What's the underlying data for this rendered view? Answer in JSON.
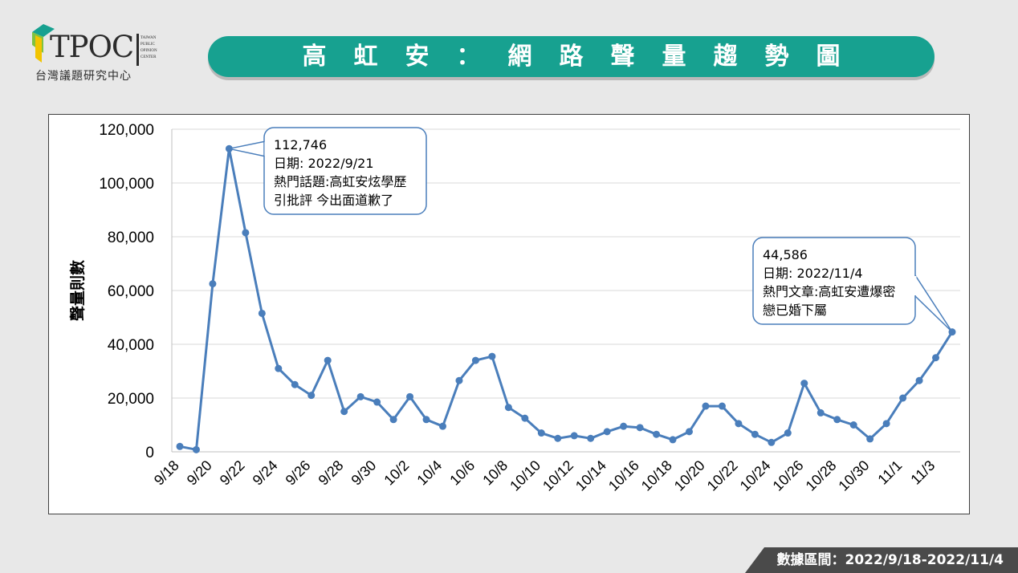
{
  "logo": {
    "wordmark": "TPOC",
    "side_text": "TAIWAN PUBLIC OPINION CENTER",
    "org_name": "台灣議題研究中心"
  },
  "title": "高虹安：網路聲量趨勢圖",
  "footer": {
    "label": "數據區間：2022/9/18-2022/11/4"
  },
  "colors": {
    "accent": "#17a190",
    "line": "#4a7ebb",
    "footer_bg": "#4a4a4a"
  },
  "chart_data": {
    "type": "line",
    "ylabel": "聲量則數",
    "ylim": [
      0,
      120000
    ],
    "yticks": [
      "0",
      "20,000",
      "40,000",
      "60,000",
      "80,000",
      "100,000",
      "120,000"
    ],
    "ytick_values": [
      0,
      20000,
      40000,
      60000,
      80000,
      100000,
      120000
    ],
    "grid": true,
    "xtick_labels": [
      "9/18",
      "9/20",
      "9/22",
      "9/24",
      "9/26",
      "9/28",
      "9/30",
      "10/2",
      "10/4",
      "10/6",
      "10/8",
      "10/10",
      "10/12",
      "10/14",
      "10/16",
      "10/18",
      "10/20",
      "10/22",
      "10/24",
      "10/26",
      "10/28",
      "10/30",
      "11/1",
      "11/3"
    ],
    "categories": [
      "9/18",
      "9/19",
      "9/20",
      "9/21",
      "9/22",
      "9/23",
      "9/24",
      "9/25",
      "9/26",
      "9/27",
      "9/28",
      "9/29",
      "9/30",
      "10/1",
      "10/2",
      "10/3",
      "10/4",
      "10/5",
      "10/6",
      "10/7",
      "10/8",
      "10/9",
      "10/10",
      "10/11",
      "10/12",
      "10/13",
      "10/14",
      "10/15",
      "10/16",
      "10/17",
      "10/18",
      "10/19",
      "10/20",
      "10/21",
      "10/22",
      "10/23",
      "10/24",
      "10/25",
      "10/26",
      "10/27",
      "10/28",
      "10/29",
      "10/30",
      "10/31",
      "11/1",
      "11/2",
      "11/3",
      "11/4"
    ],
    "values": [
      2000,
      800,
      62500,
      112746,
      81500,
      51500,
      31000,
      25000,
      21000,
      34000,
      15000,
      20500,
      18500,
      12000,
      20500,
      12000,
      9500,
      26500,
      34000,
      35500,
      16500,
      12500,
      7000,
      5000,
      6000,
      5000,
      7500,
      9500,
      9000,
      6500,
      4500,
      7500,
      17000,
      17000,
      10500,
      6500,
      3500,
      7000,
      25500,
      14500,
      12000,
      10000,
      4800,
      10500,
      20000,
      26500,
      35000,
      44586
    ],
    "annotations": [
      {
        "index": 3,
        "lines": [
          "112,746",
          "日期: 2022/9/21",
          "熱門話題:高虹安炫學歷",
          "引批評 今出面道歉了"
        ]
      },
      {
        "index": 47,
        "lines": [
          "44,586",
          "日期: 2022/11/4",
          "熱門文章:高虹安遭爆密",
          "戀已婚下屬"
        ]
      }
    ]
  }
}
